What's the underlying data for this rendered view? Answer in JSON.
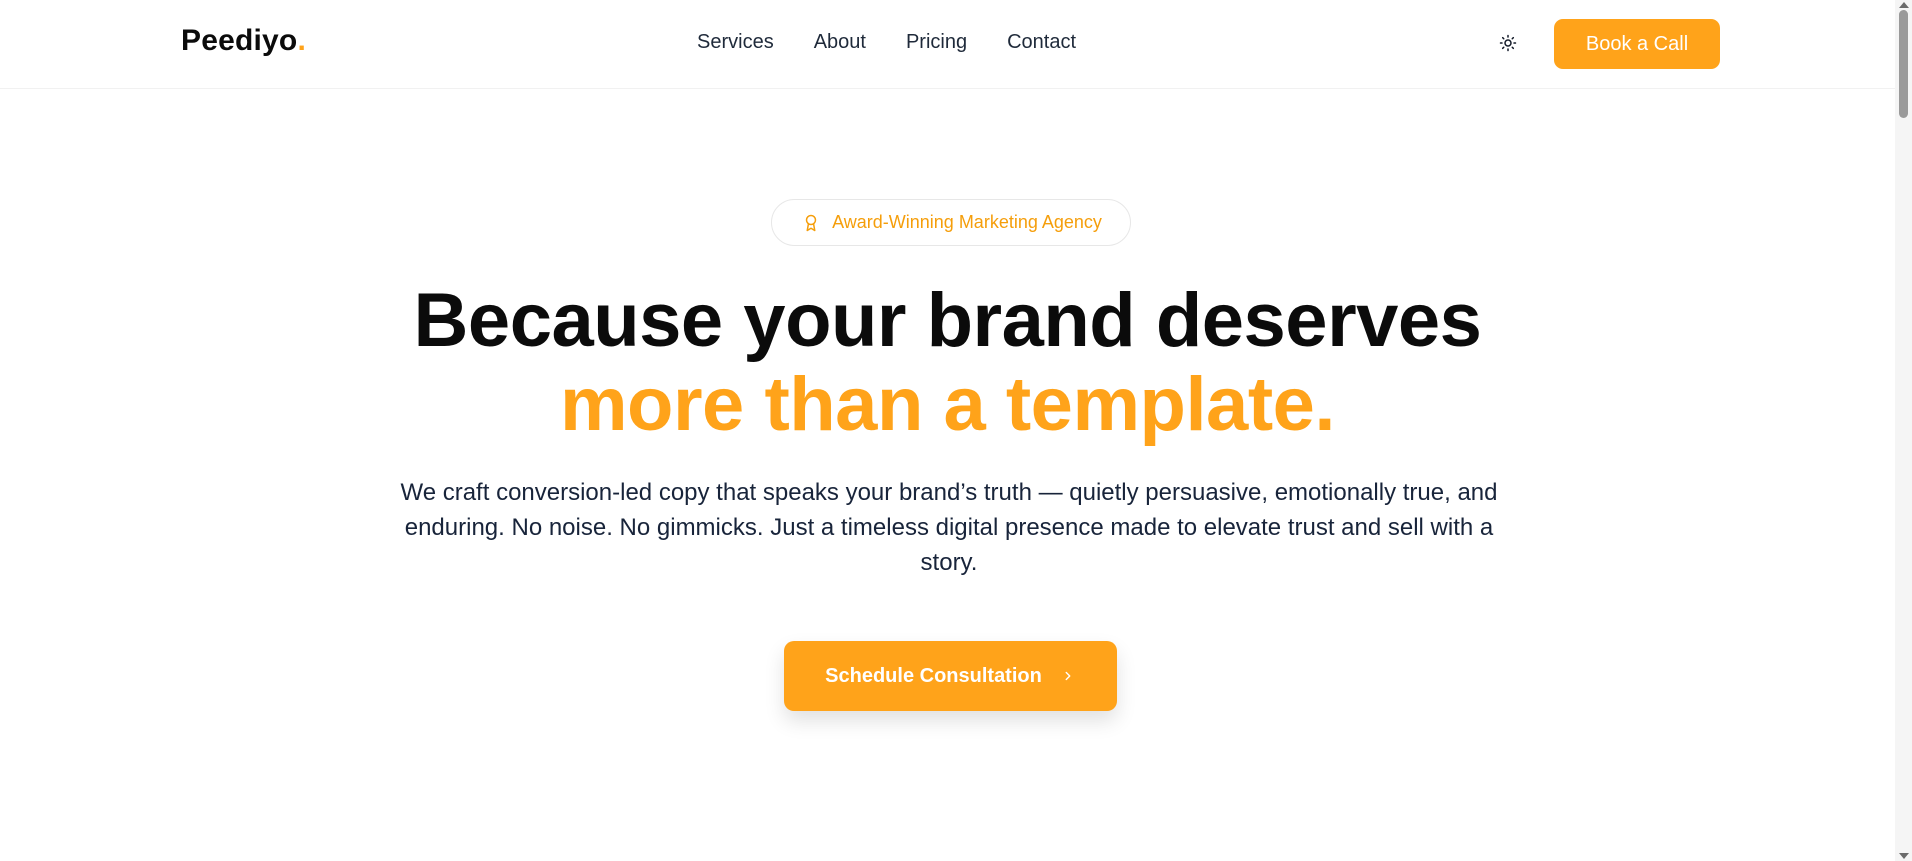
{
  "brand": {
    "name": "Peediyo",
    "dot": "."
  },
  "nav": {
    "items": [
      {
        "label": "Services"
      },
      {
        "label": "About"
      },
      {
        "label": "Pricing"
      },
      {
        "label": "Contact"
      }
    ]
  },
  "header": {
    "theme_icon": "sun-icon",
    "book_label": "Book a Call"
  },
  "hero": {
    "badge_label": "Award-Winning Marketing Agency",
    "badge_icon": "award-icon",
    "headline_line1": "Because your brand deserves",
    "headline_line2": "more than a template.",
    "subtext": "We craft conversion-led copy that speaks your brand’s truth — quietly persuasive, emotionally true, and enduring. No noise. No gimmicks. Just a timeless digital presence made to elevate trust and sell with a story.",
    "cta_label": "Schedule Consultation",
    "cta_icon": "chevron-right-icon"
  },
  "colors": {
    "accent": "#ffa31a",
    "text": "#0b0b0b",
    "body": "#18243a"
  }
}
